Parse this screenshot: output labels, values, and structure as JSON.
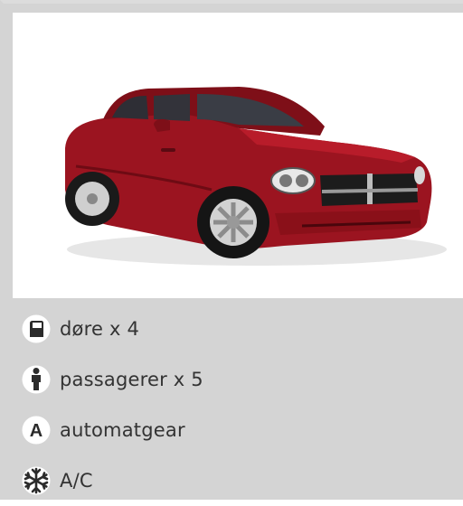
{
  "colors": {
    "panel_bg": "#d4d4d4",
    "photo_bg": "#ffffff",
    "text": "#333333",
    "icon_circle": "#ffffff",
    "icon_glyph": "#2b2b2b",
    "car_body": "#9b1420"
  },
  "vehicle": {
    "image_icon": "red-sedan-car-photo"
  },
  "features": [
    {
      "icon": "door-icon",
      "label": "døre x 4"
    },
    {
      "icon": "passenger-icon",
      "label": "passagerer x 5"
    },
    {
      "icon": "automatic-gear-icon",
      "label": "automatgear",
      "glyph": "A"
    },
    {
      "icon": "snowflake-icon",
      "label": "A/C"
    }
  ]
}
